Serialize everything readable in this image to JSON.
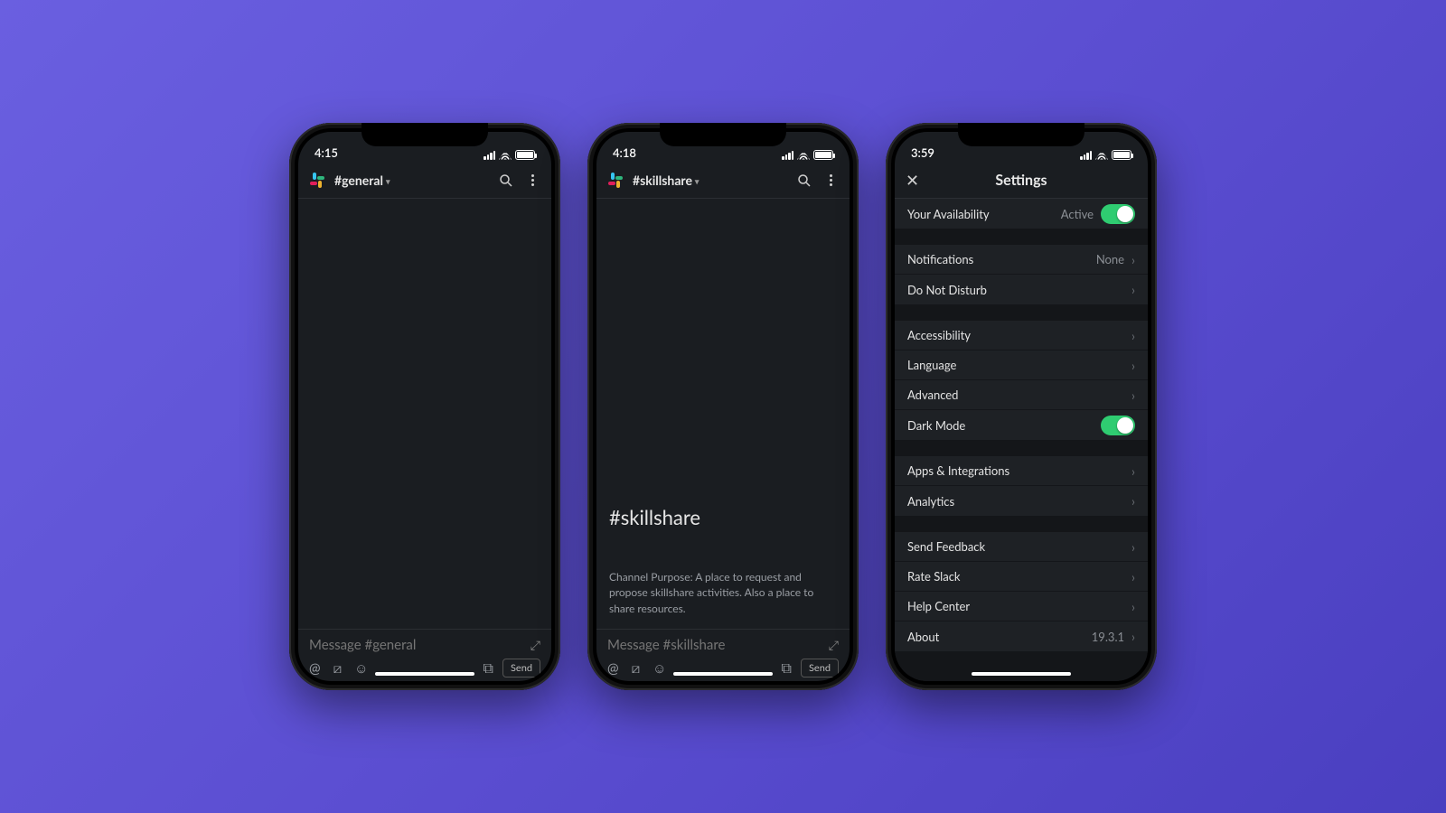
{
  "phone1": {
    "time": "4:15",
    "channel": "#general",
    "placeholder": "Message #general",
    "send": "Send"
  },
  "phone2": {
    "time": "4:18",
    "channel": "#skillshare",
    "placeholder": "Message #skillshare",
    "intro_title": "#skillshare",
    "intro_purpose": "Channel Purpose: A place to request and propose skillshare activities. Also a place to share resources.",
    "send": "Send"
  },
  "phone3": {
    "time": "3:59",
    "title": "Settings",
    "availability": {
      "label": "Your Availability",
      "value": "Active"
    },
    "notifications": {
      "label": "Notifications",
      "value": "None"
    },
    "dnd": "Do Not Disturb",
    "accessibility": "Accessibility",
    "language": "Language",
    "advanced": "Advanced",
    "darkmode": "Dark Mode",
    "apps": "Apps & Integrations",
    "analytics": "Analytics",
    "feedback": "Send Feedback",
    "rate": "Rate Slack",
    "help": "Help Center",
    "about": {
      "label": "About",
      "value": "19.3.1"
    }
  }
}
